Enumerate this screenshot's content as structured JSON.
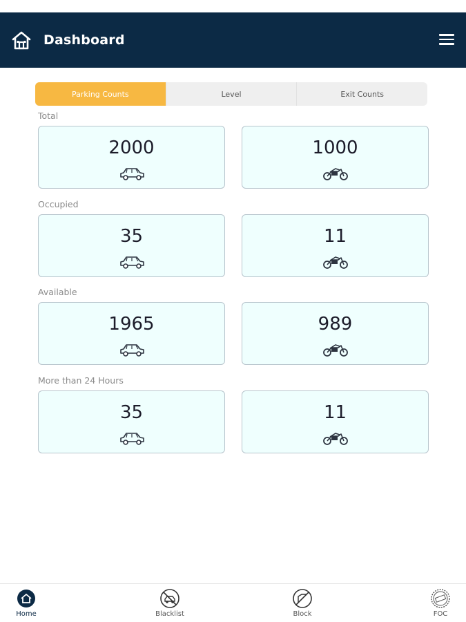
{
  "header": {
    "title": "Dashboard",
    "home_icon": "home-icon",
    "menu_icon": "hamburger-menu-icon"
  },
  "tabs": [
    {
      "label": "Parking Counts",
      "active": true
    },
    {
      "label": "Level",
      "active": false
    },
    {
      "label": "Exit Counts",
      "active": false
    }
  ],
  "sections": [
    {
      "label": "Total",
      "car": "2000",
      "bike": "1000"
    },
    {
      "label": "Occupied",
      "car": "35",
      "bike": "11"
    },
    {
      "label": "Available",
      "car": "1965",
      "bike": "989"
    },
    {
      "label": "More than 24 Hours",
      "car": "35",
      "bike": "11"
    }
  ],
  "bottom_nav": [
    {
      "label": "Home",
      "icon": "home-icon",
      "active": true
    },
    {
      "label": "Blacklist",
      "icon": "blacklist-icon",
      "active": false
    },
    {
      "label": "Block",
      "icon": "block-icon",
      "active": false
    },
    {
      "label": "FOC",
      "icon": "free-icon",
      "active": false
    }
  ],
  "colors": {
    "header_bg": "#0c2a45",
    "active_tab": "#f7b842",
    "card_bg": "#effffe",
    "card_border": "#b7c4cc"
  }
}
